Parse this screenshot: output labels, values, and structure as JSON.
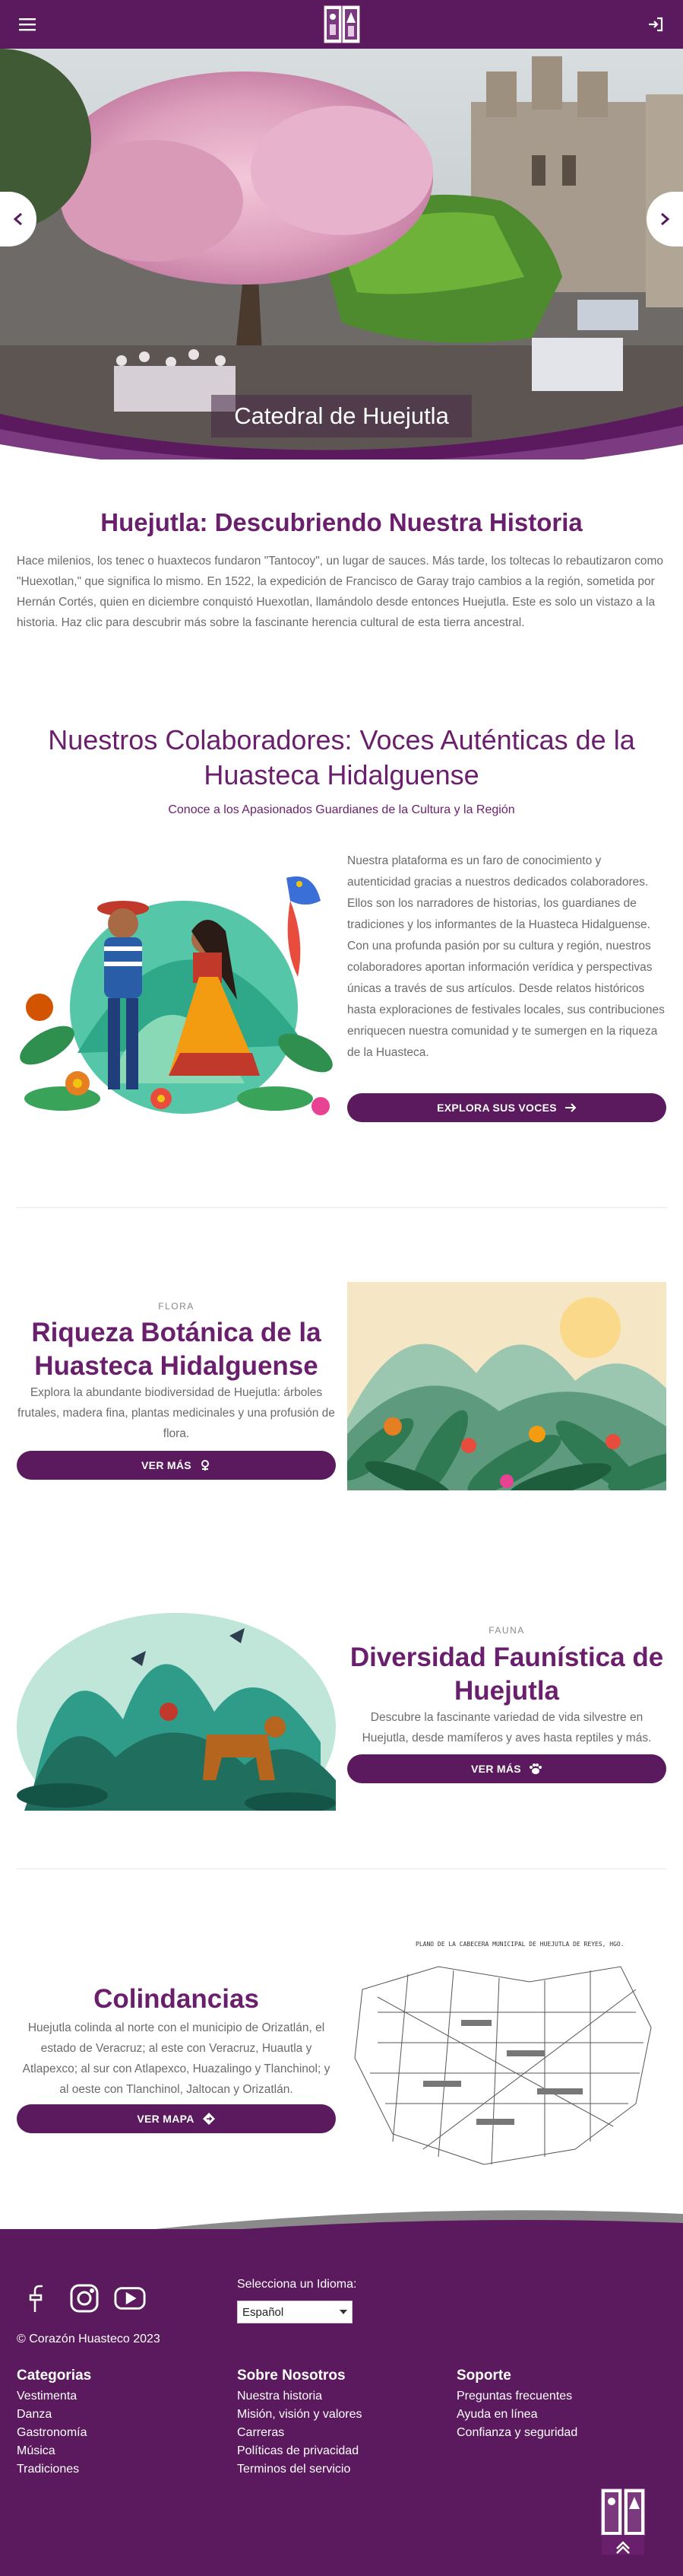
{
  "nav": {
    "menu_icon": "hamburger-menu-icon",
    "login_icon": "login-icon",
    "logo_icon": "corazon-huasteco-logo"
  },
  "hero": {
    "caption": "Catedral de Huejutla",
    "prev_icon": "chevron-left-icon",
    "next_icon": "chevron-right-icon"
  },
  "intro": {
    "title": "Huejutla: Descubriendo Nuestra Historia",
    "text": "Hace milenios, los tenec o huaxtecos fundaron \"Tantocoy\", un lugar de sauces. Más tarde, los toltecas lo rebautizaron como \"Huexotlan,\" que significa lo mismo. En 1522, la expedición de Francisco de Garay trajo cambios a la región, sometida por Hernán Cortés, quien en diciembre conquistó Huexotlan, llamándolo desde entonces Huejutla. Este es solo un vistazo a la historia. Haz clic para descubrir más sobre la fascinante herencia cultural de esta tierra ancestral."
  },
  "collaborators": {
    "title": "Nuestros Colaboradores: Voces Auténticas de la Huasteca Hidalguense",
    "subtitle": "Conoce a los Apasionados Guardianes de la Cultura y la Región",
    "text": "Nuestra plataforma es un faro de conocimiento y autenticidad gracias a nuestros dedicados colaboradores. Ellos son los narradores de historias, los guardianes de tradiciones y los informantes de la Huasteca Hidalguense. Con una profunda pasión por su cultura y región, nuestros colaboradores aportan información verídica y perspectivas únicas a través de sus artículos. Desde relatos históricos hasta exploraciones de festivales locales, sus contribuciones enriquecen nuestra comunidad y te sumergen en la riqueza de la Huasteca.",
    "button": "EXPLORA SUS VOCES",
    "button_icon": "arrow-right-icon"
  },
  "flora": {
    "eyebrow": "FLORA",
    "title": "Riqueza Botánica de la Huasteca Hidalguense",
    "text": "Explora la abundante biodiversidad de Huejutla: árboles frutales, madera fina, plantas medicinales y una profusión de flora.",
    "button": "VER MÁS",
    "button_icon": "seedling-icon"
  },
  "fauna": {
    "eyebrow": "FAUNA",
    "title": "Diversidad Faunística de Huejutla",
    "text": "Descubre la fascinante variedad de vida silvestre en Huejutla, desde mamíferos y aves hasta reptiles y más.",
    "button": "VER MÁS",
    "button_icon": "paw-icon"
  },
  "colindancias": {
    "title": "Colindancias",
    "text": "Huejutla colinda al norte con el municipio de Orizatlán, el estado de Veracruz; al este con Veracruz, Huautla y Atlapexco; al sur con Atlapexco, Huazalingo y Tlanchinol; y al oeste con Tlanchinol, Jaltocan y Orizatlán.",
    "button": "VER MAPA",
    "button_icon": "map-diamond-icon",
    "map_title": "PLANO DE LA CABECERA MUNICIPAL DE HUEJUTLA DE REYES, HGO."
  },
  "footer": {
    "social_icons": [
      "facebook-icon",
      "instagram-icon",
      "youtube-icon"
    ],
    "copyright": "© Corazón Huasteco 2023",
    "language_label": "Selecciona un Idioma:",
    "language_value": "Español",
    "columns": [
      {
        "title": "Categorias",
        "links": [
          "Vestimenta",
          "Danza",
          "Gastronomía",
          "Música",
          "Tradiciones"
        ]
      },
      {
        "title": "Sobre Nosotros",
        "links": [
          "Nuestra historia",
          "Misión, visión y valores",
          "Carreras",
          "Políticas de privacidad",
          "Terminos del servicio"
        ]
      },
      {
        "title": "Soporte",
        "links": [
          "Preguntas frecuentes",
          "Ayuda en línea",
          "Confianza y seguridad"
        ]
      }
    ],
    "scroll_top_icon": "chevrons-up-icon"
  },
  "colors": {
    "brand": "#5b1a5e",
    "accent": "#6a1f6d",
    "text": "#6b6b6b"
  }
}
